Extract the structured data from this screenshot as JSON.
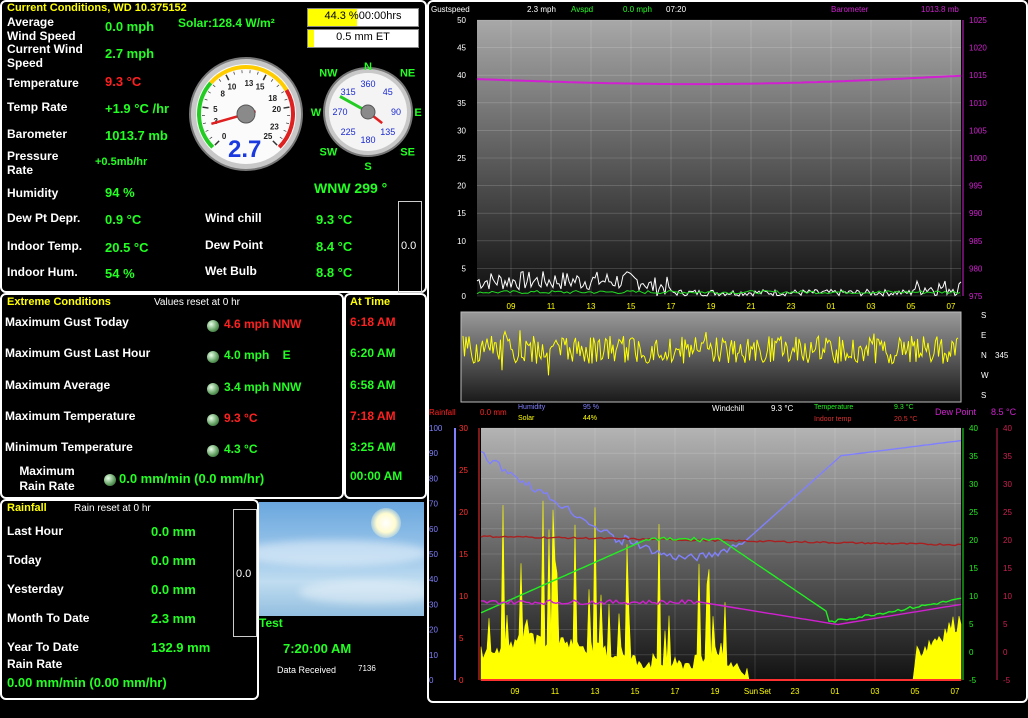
{
  "current": {
    "title": "Current Conditions, WD 10.375152",
    "solar": "Solar:128.4 W/m²",
    "rows": [
      {
        "label": "Average Wind Speed",
        "value": "0.0 mph"
      },
      {
        "label": "Current Wind Speed",
        "value": "2.7 mph"
      },
      {
        "label": "Temperature",
        "value": "9.3 °C"
      },
      {
        "label": "Temp Rate",
        "value": "+1.9 °C /hr"
      },
      {
        "label": "Barometer",
        "value": "1013.7 mb"
      },
      {
        "label": "Pressure Rate",
        "value": "+0.5mb/hr"
      },
      {
        "label": "Humidity",
        "value": "94 %"
      },
      {
        "label": "Dew Pt Depr.",
        "value": "0.9 °C"
      },
      {
        "label": "Indoor Temp.",
        "value": "20.5 °C"
      },
      {
        "label": "Indoor Hum.",
        "value": "54 %"
      }
    ],
    "right_rows": [
      {
        "label": "Wind chill",
        "value": "9.3 °C"
      },
      {
        "label": "Dew Point",
        "value": "8.4 °C"
      },
      {
        "label": "Wet Bulb",
        "value": "8.8 °C"
      }
    ],
    "sun_bar": "44.3 %00:00hrs",
    "sun_pct": 0.443,
    "et_bar": "0.5 mm ET",
    "et_pct": 0.05,
    "vbar_value": "0.0",
    "speed_gauge": {
      "value": "2.7",
      "ticks": [
        "0",
        "3",
        "5",
        "8",
        "10",
        "13",
        "15",
        "18",
        "20",
        "23",
        "25"
      ],
      "reading": 2.7,
      "max": 25
    },
    "compass": {
      "N": "N",
      "NE": "NE",
      "E": "E",
      "SE": "SE",
      "S": "S",
      "SW": "SW",
      "W": "W",
      "NW": "NW",
      "degs": [
        "360",
        "45",
        "90",
        "135",
        "180",
        "225",
        "270",
        "315"
      ],
      "direction": "WNW 299 °",
      "heading": 299
    }
  },
  "extreme": {
    "title": "Extreme Conditions",
    "reset": "Values reset at 0 hr",
    "at_time": "At Time",
    "rows": [
      {
        "label": "Maximum Gust Today",
        "value": "4.6 mph NNW",
        "time": "6:18 AM",
        "hot": true
      },
      {
        "label": "Maximum Gust Last Hour",
        "value": "4.0 mph    E",
        "time": "6:20 AM",
        "hot": false
      },
      {
        "label": "Maximum Average",
        "value": "3.4 mph NNW",
        "time": "6:58 AM",
        "hot": false
      },
      {
        "label": "Maximum Temperature",
        "value": "9.3 °C",
        "time": "7:18 AM",
        "hot": true
      },
      {
        "label": "Minimum Temperature",
        "value": "4.3 °C",
        "time": "3:25 AM",
        "hot": false
      },
      {
        "label": "Maximum Rain Rate",
        "value": "0.0 mm/min (0.0 mm/hr)",
        "time": "00:00 AM",
        "hot": false
      }
    ]
  },
  "rainfall": {
    "title": "Rainfall",
    "reset": "Rain reset at 0 hr",
    "rows": [
      {
        "label": "Last Hour",
        "value": "0.0 mm"
      },
      {
        "label": "Today",
        "value": "0.0 mm"
      },
      {
        "label": "Yesterday",
        "value": "0.0 mm"
      },
      {
        "label": "Month To Date",
        "value": "2.3 mm"
      },
      {
        "label": "Year To Date",
        "value": "132.9 mm"
      }
    ],
    "rate_label": "Rain Rate",
    "rate_value": "0.00 mm/min (0.00 mm/hr)",
    "vbar_value": "0.0"
  },
  "status": {
    "name": "Test",
    "time": "7:20:00 AM",
    "data_received_label": "Data Received",
    "data_received_value": "7136"
  },
  "wind_chart": {
    "header": {
      "gust": "Gustspeed",
      "gust_val": "2.3 mph",
      "avg": "Avspd",
      "avg_val": "0.0 mph",
      "time": "07:20",
      "baro": "Barometer",
      "baro_val": "1013.8 mb"
    },
    "left_ticks": [
      "50",
      "45",
      "40",
      "35",
      "30",
      "25",
      "20",
      "15",
      "10",
      "5",
      "0"
    ],
    "right_ticks": [
      "1025",
      "1020",
      "1015",
      "1010",
      "1005",
      "1000",
      "995",
      "990",
      "985",
      "980",
      "975"
    ],
    "hours": [
      "09",
      "11",
      "13",
      "15",
      "17",
      "19",
      "21",
      "23",
      "01",
      "03",
      "05",
      "07"
    ],
    "dir_labels": [
      "S",
      "E",
      "N",
      "W",
      "S"
    ],
    "dir_value": "345",
    "colors": {
      "baro": "#d020d0",
      "gust": "#ffffff",
      "avg": "#22dd22",
      "dir": "#ffff00"
    }
  },
  "temp_chart": {
    "header": {
      "rain": "Rainfall",
      "rain_val": "0.0 mm",
      "hum": "Humidity",
      "hum_val": "95 %",
      "solar": "Solar",
      "solar_val": "44%",
      "wc": "Windchill",
      "wc_val": "9.3 °C",
      "temp": "Temperature",
      "temp_val": "9.3 °C",
      "indoor": "Indoor temp",
      "indoor_val": "20.5 °C",
      "dew": "Dew Point",
      "dew_val": "8.5 °C"
    },
    "hum_ticks": [
      "100",
      "90",
      "80",
      "70",
      "60",
      "50",
      "40",
      "30",
      "20",
      "10",
      "0"
    ],
    "rain_ticks": [
      "30",
      "25",
      "20",
      "15",
      "10",
      "5",
      "0"
    ],
    "temp_ticks": [
      "40",
      "35",
      "30",
      "25",
      "20",
      "15",
      "10",
      "5",
      "0",
      "-5"
    ],
    "hours": [
      "09",
      "11",
      "13",
      "15",
      "17",
      "19",
      "Sun",
      "23",
      "01",
      "03",
      "05",
      "07"
    ],
    "sunset": "Set",
    "colors": {
      "humidity": "#8080ff",
      "temperature": "#22ee22",
      "indoor": "#aa2020",
      "dew": "#d020d0",
      "solar": "#ffff00"
    }
  }
}
